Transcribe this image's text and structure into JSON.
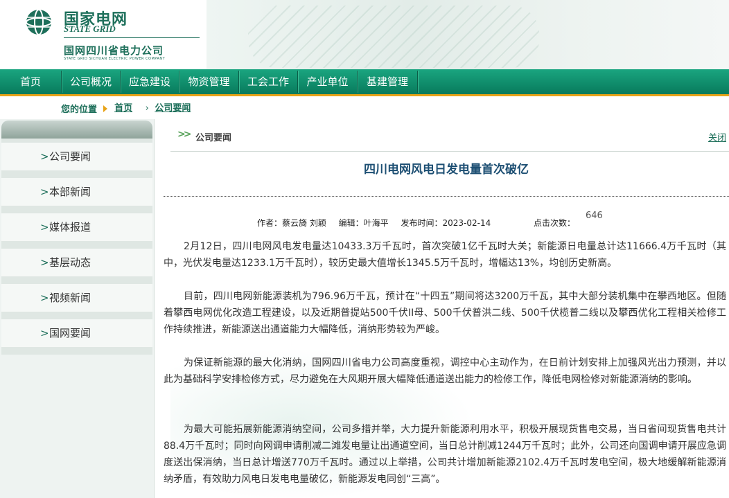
{
  "header": {
    "logo_cn": "国家电网",
    "logo_en": "STATE GRID",
    "company": "国网四川省电力公司",
    "company_en": "STATE GRID SICHUAN ELECTRIC POWER COMPANY",
    "brand_color": "#1d6f5a"
  },
  "nav": {
    "items": [
      "首页",
      "公司概况",
      "应急建设",
      "物资管理",
      "工会工作",
      "产业单位",
      "基建管理"
    ],
    "bg_color": "#0f8f6c",
    "accent_color": "#e8a317"
  },
  "breadcrumb": {
    "label": "您的位置",
    "items": [
      "首页",
      "公司要闻"
    ]
  },
  "sidebar": {
    "items": [
      "公司要闻",
      "本部新闻",
      "媒体报道",
      "基层动态",
      "视频新闻",
      "国网要闻"
    ]
  },
  "section": {
    "title": "公司要闻",
    "close": "关闭"
  },
  "article": {
    "title": "四川电网风电日发电量首次破亿",
    "author": "作者：蔡云旖 刘颖",
    "editor": "编辑：叶海平",
    "date": "发布时间：2023-02-14",
    "hits_label": "点击次数：",
    "hits_value": "646",
    "paragraphs": [
      "2月12日，四川电网风电发电量达10433.3万千瓦时，首次突破1亿千瓦时大关；新能源日电量总计达11666.4万千瓦时（其中，光伏发电量达1233.1万千瓦时），较历史最大值增长1345.5万千瓦时，增幅达13%，均创历史新高。",
      "目前，四川电网新能源装机为796.96万千瓦，预计在“十四五”期间将达3200万千瓦，其中大部分装机集中在攀西地区。但随着攀西电网优化改造工程建设，以及近期普提站500千伏II母、500千伏普洪二线、500千伏榄普二线以及攀西优化工程相关检修工作持续推进，新能源送出通道能力大幅降低，消纳形势较为严峻。",
      "为保证新能源的最大化消纳，国网四川省电力公司高度重视，调控中心主动作为，在日前计划安排上加强风光出力预测，并以此为基础科学安排检修方式，尽力避免在大风期开展大幅降低通道送出能力的检修工作，降低电网检修对新能源消纳的影响。",
      "为最大可能拓展新能源消纳空间，公司多措并举，大力提升新能源利用水平，积极开展现货售电交易，当日省间现货售电共计88.4万千瓦时；同时向网调申请削减二滩发电量让出通道空间，当日总计削减1244万千瓦时；此外，公司还向国调申请开展应急调度送出保消纳，当日总计增送770万千瓦时。通过以上举措，公司共计增加新能源2102.4万千瓦时发电空间，极大地缓解新能源消纳矛盾，有效助力风电日发电电量破亿，新能源发电同创“三高”。"
    ]
  }
}
